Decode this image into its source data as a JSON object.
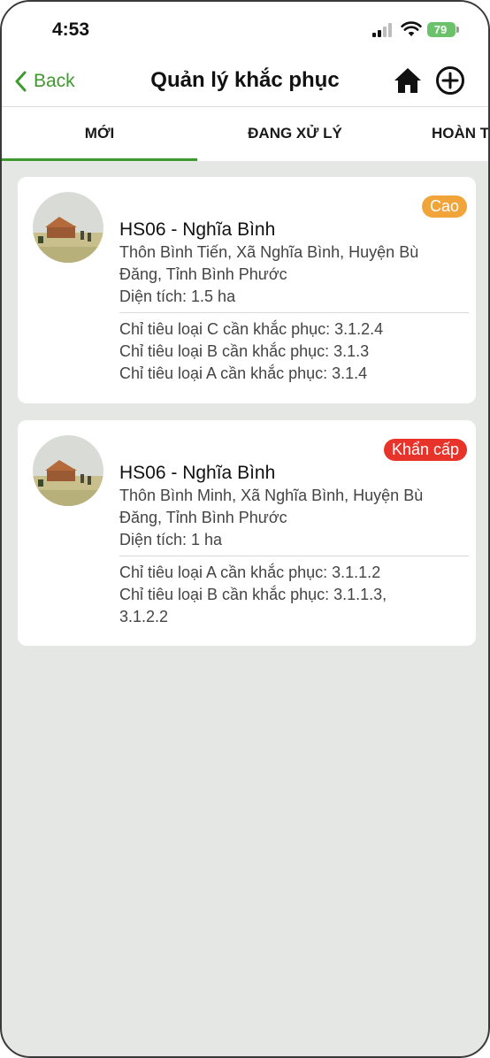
{
  "status_bar": {
    "time": "4:53",
    "battery": "79"
  },
  "nav": {
    "back_label": "Back",
    "title": "Quản lý khắc phục",
    "home_icon": "home-icon",
    "add_icon": "plus-circle-icon",
    "accent_color": "#3e9a2e"
  },
  "tabs": [
    {
      "label": "MỚI",
      "selected": true
    },
    {
      "label": "ĐANG XỬ LÝ",
      "selected": false
    },
    {
      "label": "HOÀN T",
      "selected": false
    }
  ],
  "cards": [
    {
      "title": "HS06 - Nghĩa Bình",
      "address_line1": "Thôn Bình Tiến, Xã Nghĩa Bình, Huyện Bù",
      "address_line2": "Đăng, Tỉnh Bình Phước",
      "area": "Diện tích: 1.5 ha",
      "priority": "Cao",
      "priority_color": "#f0a43a",
      "criteria": [
        "Chỉ tiêu loại C cần khắc phục: 3.1.2.4",
        "Chỉ tiêu loại B cần khắc phục: 3.1.3",
        "Chỉ tiêu loại A cần khắc phục: 3.1.4"
      ]
    },
    {
      "title": "HS06 - Nghĩa Bình",
      "address_line1": "Thôn Bình Minh, Xã Nghĩa Bình, Huyện Bù",
      "address_line2": "Đăng, Tỉnh Bình Phước",
      "area": "Diện tích: 1 ha",
      "priority": "Khẩn cấp",
      "priority_color": "#e8332b",
      "criteria": [
        "Chỉ tiêu loại A cần khắc phục: 3.1.1.2",
        "Chỉ tiêu loại B cần khắc phục: 3.1.1.3,",
        "3.1.2.2"
      ]
    }
  ]
}
